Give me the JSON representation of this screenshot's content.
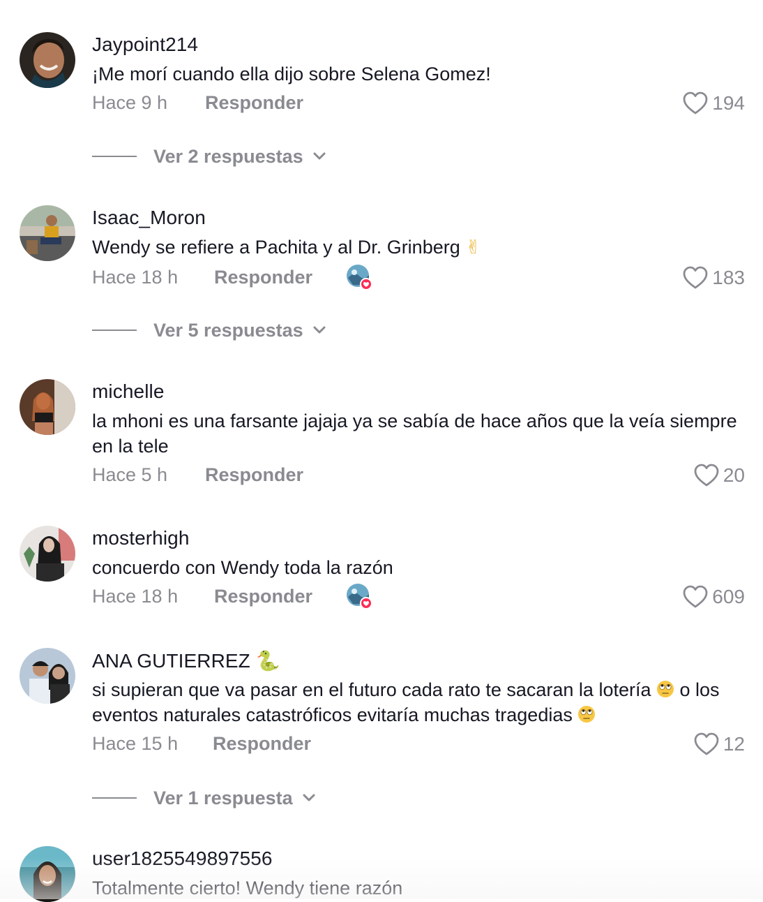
{
  "comments": [
    {
      "username": "Jaypoint214",
      "text": "¡Me morí cuando ella dijo sobre Selena Gomez!",
      "time": "Hace 9 h",
      "reply_label": "Responder",
      "likes": "194",
      "view_replies": "Ver 2 respuestas"
    },
    {
      "username": "Isaac_Moron",
      "text": "Wendy se refiere a Pachita y al Dr. Grinberg",
      "text_emoji": "✌",
      "time": "Hace 18 h",
      "reply_label": "Responder",
      "likes": "183",
      "view_replies": "Ver 5 respuestas"
    },
    {
      "username": "michelle",
      "text": "la mhoni es una farsante jajaja ya se sabía de hace años que la veía siempre en la tele",
      "time": "Hace 5 h",
      "reply_label": "Responder",
      "likes": "20"
    },
    {
      "username": "mosterhigh",
      "text": "concuerdo con Wendy toda la razón",
      "time": "Hace 18 h",
      "reply_label": "Responder",
      "likes": "609"
    },
    {
      "username": "ANA GUTIERREZ",
      "username_emoji": "🐍",
      "text_part1": "si supieran que va pasar en el futuro cada rato te sacaran la lotería",
      "text_part2": "o los eventos naturales catastróficos evitaría muchas tragedias",
      "time": "Hace 15 h",
      "reply_label": "Responder",
      "likes": "12",
      "view_replies": "Ver 1 respuesta"
    },
    {
      "username": "user1825549897556",
      "text": "Totalmente cierto! Wendy tiene razón"
    }
  ],
  "colors": {
    "primary_text": "#161823",
    "secondary_text": "#8a8b91",
    "badge_heart": "#fe2c55"
  }
}
